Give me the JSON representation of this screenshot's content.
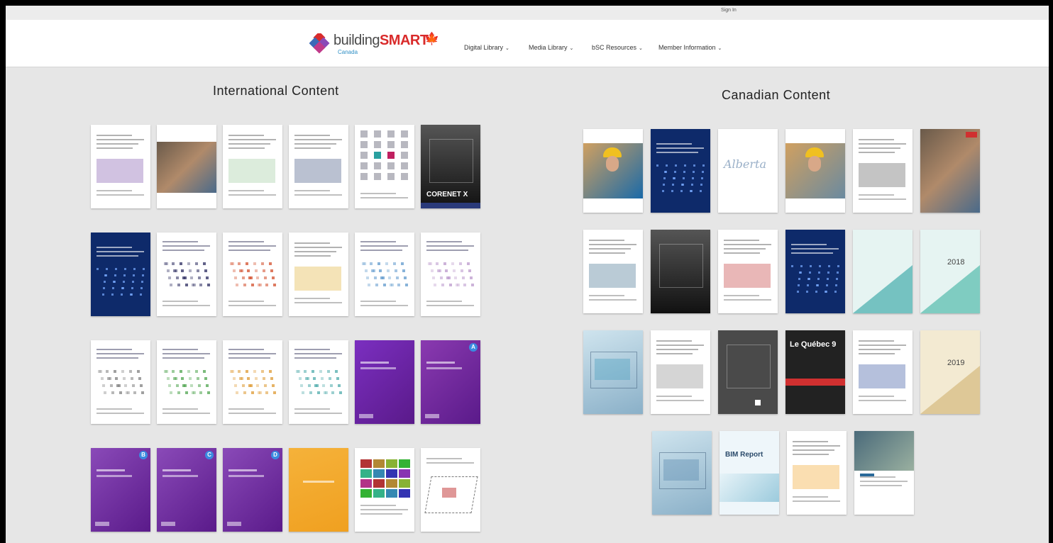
{
  "header": {
    "sign_in": "Sign In",
    "logo": {
      "word1": "building",
      "word2": "SMART",
      "sub": "Canada"
    },
    "nav": [
      "Digital Library",
      "Media Library",
      "bSC Resources",
      "Member Information"
    ]
  },
  "sections": {
    "international": {
      "title": "International Content",
      "thumbs": [
        {
          "style": "doc-white",
          "accent": "#7b4fa8"
        },
        {
          "style": "photo",
          "accent": "#8a6a4a"
        },
        {
          "style": "doc-green",
          "accent": "#9bc99b"
        },
        {
          "style": "doc-navy",
          "accent": "#3a4d7a"
        },
        {
          "style": "squares",
          "accent": "#c02060"
        },
        {
          "style": "dark",
          "accent": "#2a3a7a",
          "label": "CORENET X"
        },
        {
          "style": "navy-dots",
          "accent": "#1a3a8a"
        },
        {
          "style": "dots",
          "accent": "#3a3a6a"
        },
        {
          "style": "dots",
          "accent": "#d65a3a"
        },
        {
          "style": "doc-plain",
          "accent": "#e0b030"
        },
        {
          "style": "dots",
          "accent": "#6aa0d0"
        },
        {
          "style": "dots",
          "accent": "#c0a0d0"
        },
        {
          "style": "dots",
          "accent": "#888888"
        },
        {
          "style": "dots",
          "accent": "#5aaa5a"
        },
        {
          "style": "dots",
          "accent": "#e0a040"
        },
        {
          "style": "dots",
          "accent": "#5ab0b0"
        },
        {
          "style": "purple",
          "accent": "#7b2fc0"
        },
        {
          "style": "purple",
          "accent": "#8a3ab0",
          "badge": "A"
        },
        {
          "style": "purple",
          "accent": "#8a4ab8",
          "badge": "B"
        },
        {
          "style": "purple",
          "accent": "#8a4ab8",
          "badge": "C"
        },
        {
          "style": "purple",
          "accent": "#8a4ab8",
          "badge": "D"
        },
        {
          "style": "orange",
          "accent": "#f0a020"
        },
        {
          "style": "colorgrid",
          "accent": "#2a8a4a"
        },
        {
          "style": "sketch",
          "accent": "#c03030"
        }
      ]
    },
    "canadian": {
      "title": "Canadian Content",
      "thumbs": [
        {
          "style": "worker",
          "accent": "#1a6aa8"
        },
        {
          "style": "navy-blue",
          "accent": "#1a3a8a"
        },
        {
          "style": "script",
          "accent": "#9ab0c8",
          "label": "Alberta"
        },
        {
          "style": "worker2",
          "accent": "#6a8aa0"
        },
        {
          "style": "doc-plain",
          "accent": "#555555"
        },
        {
          "style": "city",
          "accent": "#2a7ab8"
        },
        {
          "style": "doc-map",
          "accent": "#3a6a8a"
        },
        {
          "style": "black-building",
          "accent": "#222222"
        },
        {
          "style": "doc-red",
          "accent": "#c03030"
        },
        {
          "style": "navy-city",
          "accent": "#1a4a8a"
        },
        {
          "style": "teal-tri",
          "accent": "#2aa0a0"
        },
        {
          "style": "teal-geo",
          "accent": "#3ab0a0",
          "label": "2018"
        },
        {
          "style": "interior",
          "accent": "#4aa0c0"
        },
        {
          "style": "doc-text",
          "accent": "#888888"
        },
        {
          "style": "dark-gray",
          "accent": "#444444"
        },
        {
          "style": "quebec",
          "accent": "#d03030",
          "label": "Le Québec 9"
        },
        {
          "style": "doc-blue",
          "accent": "#2a4a9a"
        },
        {
          "style": "cream-geo",
          "accent": "#d0b070",
          "label": "2019"
        },
        {
          "style": "model",
          "accent": "#5a8ab0"
        },
        {
          "style": "bim-report",
          "accent": "#4aa0c0",
          "label": "BIM Report"
        },
        {
          "style": "doc-orange",
          "accent": "#f0a020"
        },
        {
          "style": "deloitte",
          "accent": "#2a6a9a"
        }
      ]
    }
  }
}
